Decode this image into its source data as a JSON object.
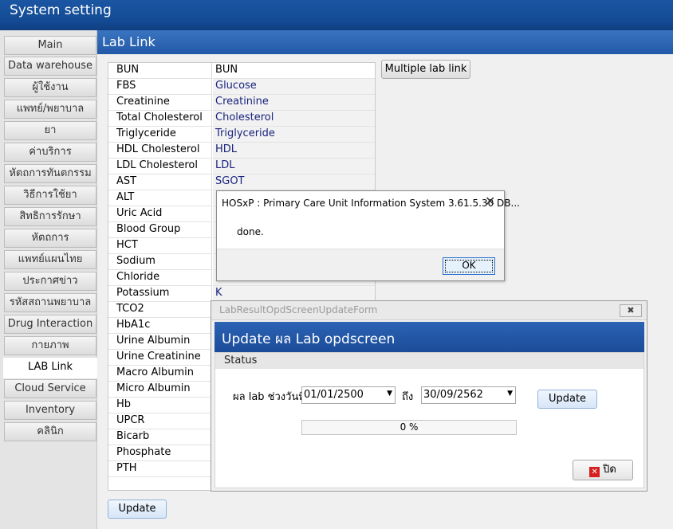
{
  "app": {
    "title": "System setting"
  },
  "sidebar": {
    "items": [
      {
        "label": "Main"
      },
      {
        "label": "Data warehouse"
      },
      {
        "label": "ผู้ใช้งาน"
      },
      {
        "label": "แพทย์/พยาบาล"
      },
      {
        "label": "ยา"
      },
      {
        "label": "ค่าบริการ"
      },
      {
        "label": "หัตถการทันตกรรม"
      },
      {
        "label": "วิธีการใช้ยา"
      },
      {
        "label": "สิทธิการรักษา"
      },
      {
        "label": "หัตถการ"
      },
      {
        "label": "แพทย์แผนไทย"
      },
      {
        "label": "ประกาศข่าว"
      },
      {
        "label": "รหัสสถานพยาบาล"
      },
      {
        "label": "Drug Interaction"
      },
      {
        "label": "กายภาพ"
      },
      {
        "label": "LAB Link"
      },
      {
        "label": "Cloud Service"
      },
      {
        "label": "Inventory"
      },
      {
        "label": "คลินิก"
      }
    ]
  },
  "panel": {
    "title": "Lab Link"
  },
  "lab_grid": {
    "rows": [
      {
        "name": "BUN",
        "link": "BUN"
      },
      {
        "name": "FBS",
        "link": "Glucose"
      },
      {
        "name": "Creatinine",
        "link": "Creatinine"
      },
      {
        "name": "Total Cholesterol",
        "link": "Cholesterol"
      },
      {
        "name": "Triglyceride",
        "link": "Triglyceride"
      },
      {
        "name": "HDL Cholesterol",
        "link": "HDL"
      },
      {
        "name": "LDL Cholesterol",
        "link": "LDL"
      },
      {
        "name": "AST",
        "link": "SGOT"
      },
      {
        "name": "ALT",
        "link": ""
      },
      {
        "name": "Uric Acid",
        "link": ""
      },
      {
        "name": "Blood Group",
        "link": ""
      },
      {
        "name": "HCT",
        "link": ""
      },
      {
        "name": "Sodium",
        "link": ""
      },
      {
        "name": "Chloride",
        "link": ""
      },
      {
        "name": "Potassium",
        "link": "K"
      },
      {
        "name": "TCO2",
        "link": ""
      },
      {
        "name": "HbA1c",
        "link": ""
      },
      {
        "name": "Urine Albumin",
        "link": ""
      },
      {
        "name": "Urine Creatinine",
        "link": ""
      },
      {
        "name": "Macro Albumin",
        "link": ""
      },
      {
        "name": "Micro Albumin",
        "link": ""
      },
      {
        "name": "Hb",
        "link": ""
      },
      {
        "name": "UPCR",
        "link": ""
      },
      {
        "name": "Bicarb",
        "link": ""
      },
      {
        "name": "Phosphate",
        "link": ""
      },
      {
        "name": "PTH",
        "link": ""
      }
    ]
  },
  "buttons": {
    "multiple_lab_link": "Multiple lab link",
    "update": "Update"
  },
  "message_dialog": {
    "title": "HOSxP : Primary Care Unit Information System 3.61.5.30 DB...",
    "message": "done.",
    "ok_label": "OK",
    "close_glyph": "✕"
  },
  "update_dialog": {
    "window_title": "LabResultOpdScreenUpdateForm",
    "close_glyph": "✖",
    "header": "Update ผล Lab opdscreen",
    "status_label": "Status",
    "date_range_label": "ผล lab ช่วงวันที่",
    "to_label": "ถึง",
    "start_date": "01/01/2500",
    "end_date": "30/09/2562",
    "update_button": "Update",
    "progress_text": "0 %",
    "progress_value": 0,
    "close_button": "ปิด"
  }
}
